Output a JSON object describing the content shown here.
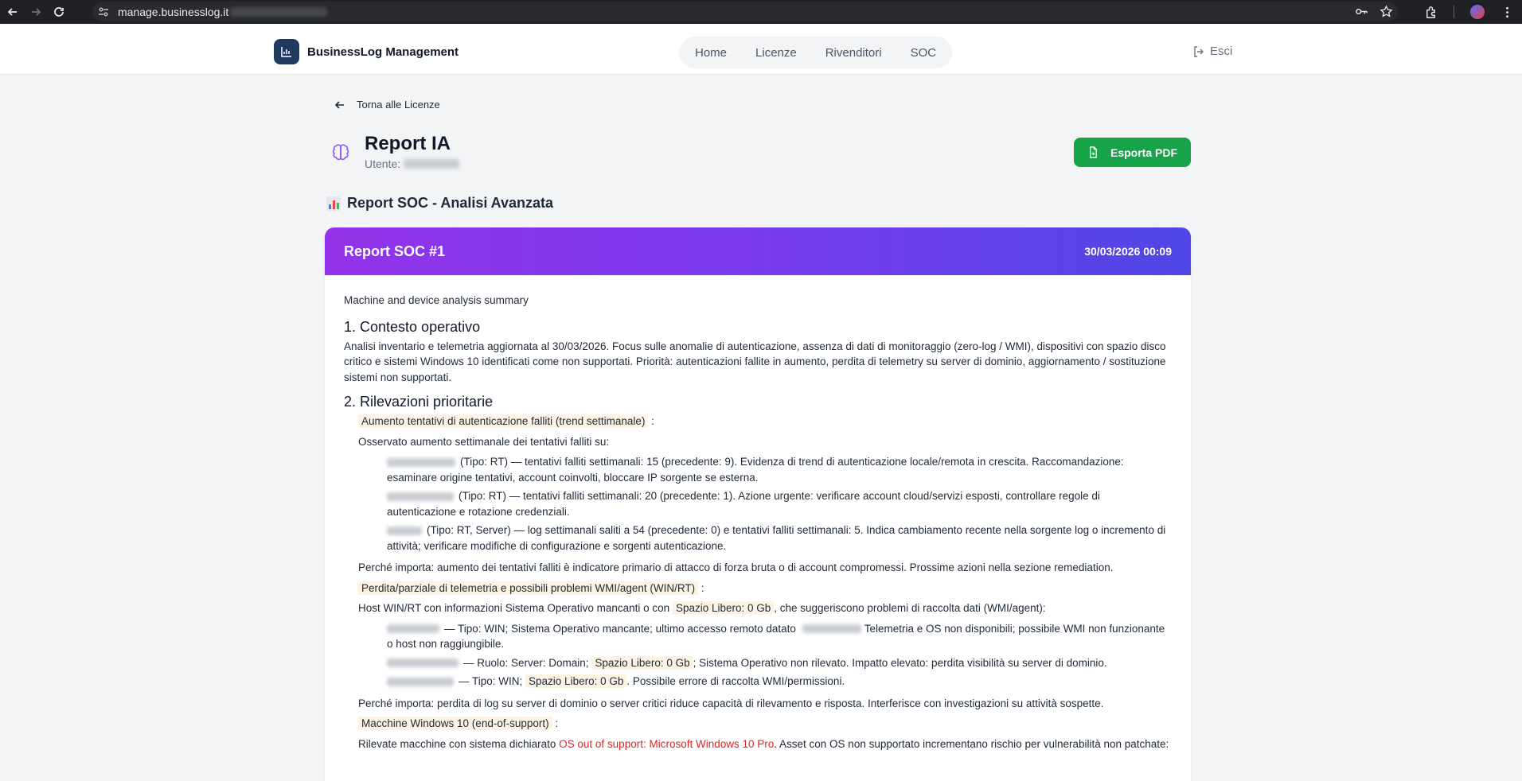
{
  "browser": {
    "url": "manage.businesslog.it"
  },
  "header": {
    "brand": "BusinessLog Management",
    "nav": [
      "Home",
      "Licenze",
      "Rivenditori",
      "SOC"
    ],
    "logout": "Esci"
  },
  "page": {
    "back_label": "Torna alle Licenze",
    "title": "Report IA",
    "user_label": "Utente:",
    "export_label": "Esporta PDF",
    "section_title": "Report SOC - Analisi Avanzata"
  },
  "report": {
    "title": "Report SOC #1",
    "date": "30/03/2026 00:09",
    "summary": "Machine and device analysis summary",
    "s1_title": "1. Contesto operativo",
    "s1_text": "Analisi inventario e telemetria aggiornata al 30/03/2026. Focus sulle anomalie di autenticazione, assenza di dati di monitoraggio (zero-log / WMI), dispositivi con spazio disco critico e sistemi Windows 10 identificati come non supportati. Priorità: autenticazioni fallite in aumento, perdita di telemetry su server di dominio, aggiornamento / sostituzione sistemi non supportati.",
    "s2_title": "2. Rilevazioni prioritarie",
    "f1_title": "Aumento tentativi di autenticazione falliti (trend settimanale)",
    "f1_intro": "Osservato aumento settimanale dei tentativi falliti su:",
    "f1_items": [
      "(Tipo: RT) — tentativi falliti settimanali: 15 (precedente: 9). Evidenza di trend di autenticazione locale/remota in crescita. Raccomandazione: esaminare origine tentativi, account coinvolti, bloccare IP sorgente se esterna.",
      "(Tipo: RT) — tentativi falliti settimanali: 20 (precedente: 1). Azione urgente: verificare account cloud/servizi esposti, controllare regole di autenticazione e rotazione credenziali.",
      "(Tipo: RT, Server) — log settimanali saliti a 54 (precedente: 0) e tentativi falliti settimanali: 5. Indica cambiamento recente nella sorgente log o incremento di attività; verificare modifiche di configurazione e sorgenti autenticazione."
    ],
    "f1_why": "Perché importa: aumento dei tentativi falliti è indicatore primario di attacco di forza bruta o di account compromessi. Prossime azioni nella sezione remediation.",
    "f2_title": "Perdita/parziale di telemetria e possibili problemi WMI/agent (WIN/RT)",
    "f2_intro_a": "Host WIN/RT con informazioni Sistema Operativo mancanti o con",
    "free_space": "Spazio Libero: 0 Gb",
    "f2_intro_b": ", che suggeriscono problemi di raccolta dati (WMI/agent):",
    "f2_item1_a": "— Tipo: WIN; Sistema Operativo mancante; ultimo accesso remoto datato",
    "f2_item1_b": "Telemetria e OS non disponibili; possibile WMI non funzionante o host non raggiungibile.",
    "f2_item2_a": "— Ruolo: Server: Domain;",
    "f2_item2_b": "; Sistema Operativo non rilevato. Impatto elevato: perdita visibilità su server di dominio.",
    "f2_item3_a": "— Tipo: WIN;",
    "f2_item3_b": ". Possibile errore di raccolta WMI/permissioni.",
    "f2_why": "Perché importa: perdita di log su server di dominio o server critici riduce capacità di rilevamento e risposta. Interferisce con investigazioni su attività sospette.",
    "f3_title": "Macchine Windows 10 (end-of-support)",
    "f3_text_a": "Rilevate macchine con sistema dichiarato",
    "f3_os": "OS out of support: Microsoft Windows 10 Pro",
    "f3_text_b": ". Asset con OS non supportato incrementano rischio per vulnerabilità non patchate:"
  },
  "colors": {
    "accent_green": "#16a34a",
    "header_gradient_start": "#9333ea",
    "header_gradient_end": "#4f46e5",
    "highlight_bg": "#fdf3e3",
    "warning_red": "#dc2626"
  }
}
